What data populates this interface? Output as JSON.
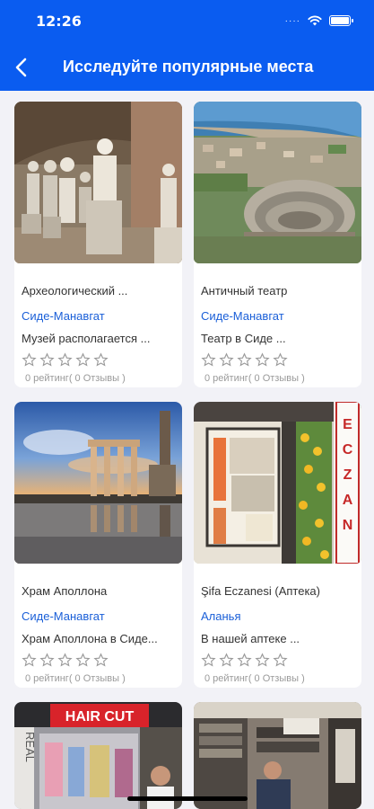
{
  "status_bar": {
    "time": "12:26",
    "signal": "····"
  },
  "header": {
    "title": "Исследуйте популярные места"
  },
  "places": [
    {
      "name": "Археологический  ...",
      "location": "Сиде-Манавгат",
      "description": "Музей располагается ...",
      "rating_text": "0 рейтинг( 0 Отзывы )"
    },
    {
      "name": "Античный театр",
      "location": "Сиде-Манавгат",
      "description": "Театр в Сиде ...",
      "rating_text": "0 рейтинг( 0 Отзывы )"
    },
    {
      "name": "Храм Аполлона",
      "location": "Сиде-Манавгат",
      "description": "Храм Аполлона в Сиде...",
      "rating_text": "0 рейтинг( 0 Отзывы )"
    },
    {
      "name": "Şifa Eczanesi (Аптека)",
      "location": "Аланья",
      "description": "В нашей аптеке ...",
      "rating_text": "0 рейтинг( 0 Отзывы )"
    }
  ],
  "image_signs": {
    "hair_cut": "HAIR CUT",
    "real": "REAL",
    "eczane": "ECZAN"
  },
  "colors": {
    "header": "#0a5cf0",
    "location_link": "#1a5fd8",
    "star_outline": "#9a9a9a"
  }
}
